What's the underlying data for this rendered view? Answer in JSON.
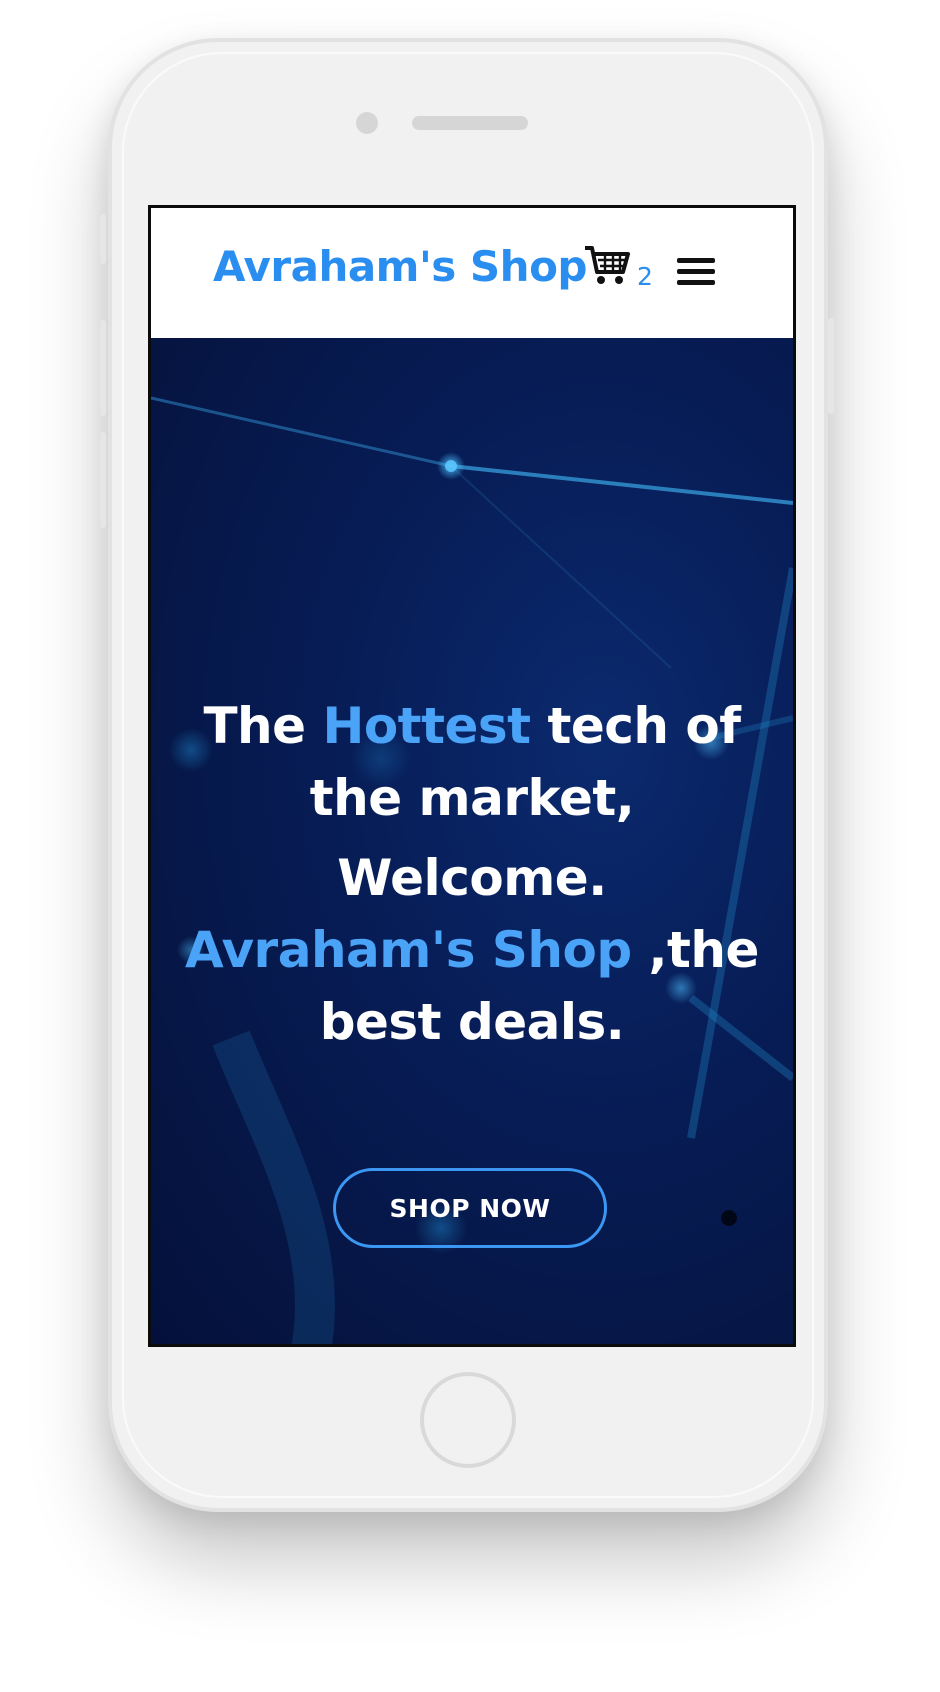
{
  "header": {
    "brand": "Avraham's Shop",
    "cart_count": "2",
    "cart_icon": "shopping-cart-icon",
    "menu_icon": "hamburger-menu-icon"
  },
  "hero": {
    "line1": {
      "prefix": "The ",
      "accent": "Hottest",
      "suffix": " tech of"
    },
    "line2": "the market,",
    "line3": "Welcome.",
    "line4": {
      "accent": "Avraham's Shop",
      "suffix": " ,the"
    },
    "line5": "best deals.",
    "cta_label": "SHOP NOW"
  },
  "colors": {
    "brand_blue": "#2a8df0",
    "accent_blue": "#4aa3f7",
    "hero_bg": "#061645",
    "cta_border": "#3c97f2",
    "text_white": "#ffffff"
  }
}
